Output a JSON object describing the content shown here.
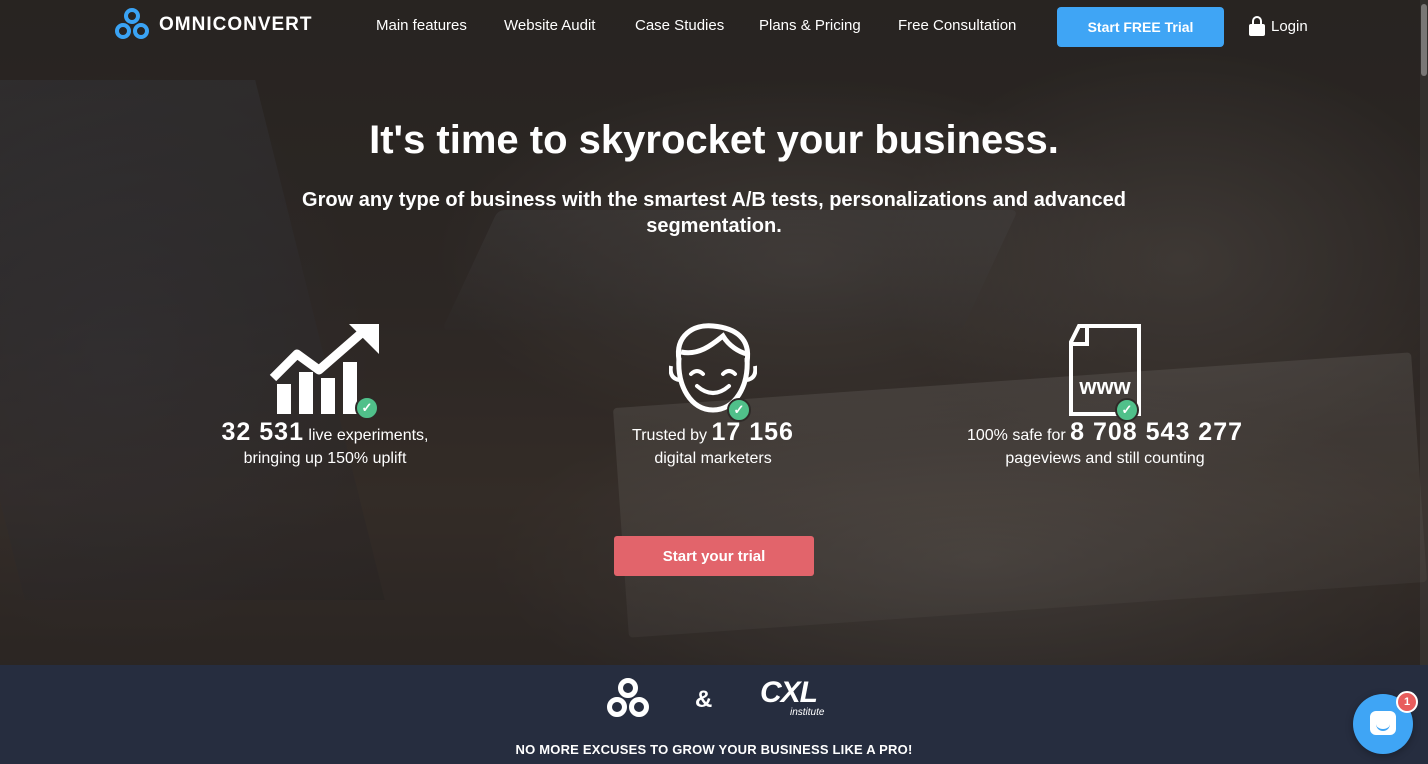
{
  "brand": {
    "name": "OMNICONVERT",
    "accent": "#3fa5f5"
  },
  "nav": {
    "items": [
      {
        "label": "Main features"
      },
      {
        "label": "Website Audit"
      },
      {
        "label": "Case Studies"
      },
      {
        "label": "Plans & Pricing"
      },
      {
        "label": "Free Consultation"
      }
    ],
    "trial_button": "Start FREE Trial",
    "login": "Login"
  },
  "hero": {
    "title": "It's time to skyrocket your business.",
    "subtitle": "Grow any type of business with the smartest A/B tests, personalizations and advanced segmentation.",
    "cta": "Start your trial",
    "cta_color": "#e2646b"
  },
  "stats": [
    {
      "icon": "growth-chart-icon",
      "prefix": "",
      "number": "32 531",
      "suffix": " live experiments,",
      "line2": "bringing up 150% uplift"
    },
    {
      "icon": "smiling-face-icon",
      "prefix": "Trusted by ",
      "number": "17 156",
      "suffix": "",
      "line2": "digital marketers"
    },
    {
      "icon": "www-document-icon",
      "prefix": "100% safe for ",
      "number": "8 708 543 277",
      "suffix": "",
      "line2": "pageviews and still counting",
      "www": "www"
    }
  ],
  "partners": {
    "amp": "&",
    "cxl": "CXL",
    "cxl_sub": "institute",
    "tagline": "NO MORE EXCUSES TO GROW YOUR BUSINESS LIKE A PRO!"
  },
  "chat": {
    "badge": "1"
  }
}
